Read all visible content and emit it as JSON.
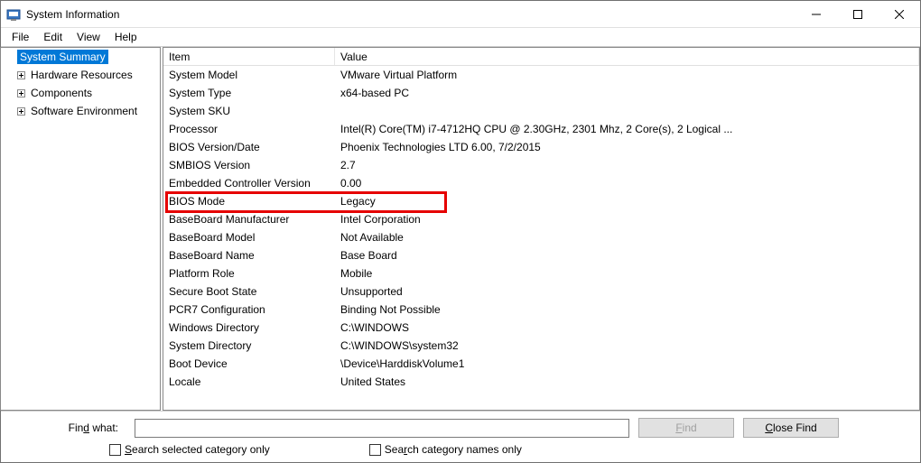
{
  "window": {
    "title": "System Information"
  },
  "menu": {
    "file": "File",
    "edit": "Edit",
    "view": "View",
    "help": "Help"
  },
  "tree": {
    "root": "System Summary",
    "children": [
      "Hardware Resources",
      "Components",
      "Software Environment"
    ]
  },
  "columns": {
    "item": "Item",
    "value": "Value"
  },
  "rows": [
    {
      "item": "System Model",
      "value": "VMware Virtual Platform"
    },
    {
      "item": "System Type",
      "value": "x64-based PC"
    },
    {
      "item": "System SKU",
      "value": ""
    },
    {
      "item": "Processor",
      "value": "Intel(R) Core(TM) i7-4712HQ CPU @ 2.30GHz, 2301 Mhz, 2 Core(s), 2 Logical ..."
    },
    {
      "item": "BIOS Version/Date",
      "value": "Phoenix Technologies LTD 6.00, 7/2/2015"
    },
    {
      "item": "SMBIOS Version",
      "value": "2.7"
    },
    {
      "item": "Embedded Controller Version",
      "value": "0.00"
    },
    {
      "item": "BIOS Mode",
      "value": "Legacy"
    },
    {
      "item": "BaseBoard Manufacturer",
      "value": "Intel Corporation"
    },
    {
      "item": "BaseBoard Model",
      "value": "Not Available"
    },
    {
      "item": "BaseBoard Name",
      "value": "Base Board"
    },
    {
      "item": "Platform Role",
      "value": "Mobile"
    },
    {
      "item": "Secure Boot State",
      "value": "Unsupported"
    },
    {
      "item": "PCR7 Configuration",
      "value": "Binding Not Possible"
    },
    {
      "item": "Windows Directory",
      "value": "C:\\WINDOWS"
    },
    {
      "item": "System Directory",
      "value": "C:\\WINDOWS\\system32"
    },
    {
      "item": "Boot Device",
      "value": "\\Device\\HarddiskVolume1"
    },
    {
      "item": "Locale",
      "value": "United States"
    }
  ],
  "highlight_row_index": 7,
  "find": {
    "label": "Find what:",
    "value": "",
    "find_btn": "Find",
    "close_btn": "Close Find",
    "chk_selected": "Search selected category only",
    "chk_names": "Search category names only"
  }
}
